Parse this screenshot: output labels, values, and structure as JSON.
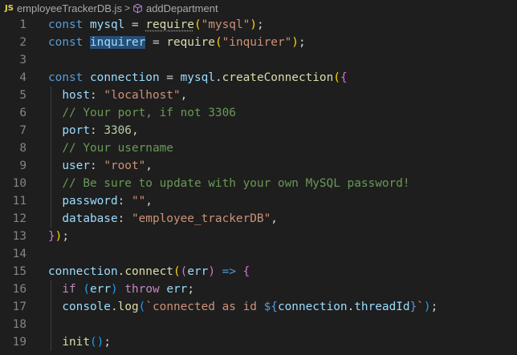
{
  "breadcrumb": {
    "file_badge": "JS",
    "file_name": "employeeTrackerDB.js",
    "separator": ">",
    "symbol_name": "addDepartment"
  },
  "code": {
    "lines": [
      {
        "n": "1",
        "tokens": [
          [
            "kw",
            "const"
          ],
          [
            "pl",
            " "
          ],
          [
            "var",
            "mysql"
          ],
          [
            "pl",
            " = "
          ],
          [
            "fn",
            "require"
          ],
          [
            "br1",
            "("
          ],
          [
            "str",
            "\"mysql\""
          ],
          [
            "br1",
            ")"
          ],
          [
            "pl",
            ";"
          ]
        ]
      },
      {
        "n": "2",
        "tokens": [
          [
            "kw",
            "const"
          ],
          [
            "pl",
            " "
          ],
          [
            "var",
            "inquirer"
          ],
          [
            "pl",
            " = "
          ],
          [
            "fn",
            "require"
          ],
          [
            "br1",
            "("
          ],
          [
            "str",
            "\"inquirer\""
          ],
          [
            "br1",
            ")"
          ],
          [
            "pl",
            ";"
          ]
        ]
      },
      {
        "n": "3",
        "tokens": []
      },
      {
        "n": "4",
        "tokens": [
          [
            "kw",
            "const"
          ],
          [
            "pl",
            " "
          ],
          [
            "var",
            "connection"
          ],
          [
            "pl",
            " = "
          ],
          [
            "var",
            "mysql"
          ],
          [
            "pl",
            "."
          ],
          [
            "fn",
            "createConnection"
          ],
          [
            "br1",
            "("
          ],
          [
            "br2",
            "{"
          ]
        ]
      },
      {
        "n": "5",
        "tokens": [
          [
            "pl",
            "  "
          ],
          [
            "var",
            "host"
          ],
          [
            "pl",
            ": "
          ],
          [
            "str",
            "\"localhost\""
          ],
          [
            "pl",
            ","
          ]
        ]
      },
      {
        "n": "6",
        "tokens": [
          [
            "pl",
            "  "
          ],
          [
            "cm",
            "// Your port, if not 3306"
          ]
        ]
      },
      {
        "n": "7",
        "tokens": [
          [
            "pl",
            "  "
          ],
          [
            "var",
            "port"
          ],
          [
            "pl",
            ": "
          ],
          [
            "num",
            "3306"
          ],
          [
            "pl",
            ","
          ]
        ]
      },
      {
        "n": "8",
        "tokens": [
          [
            "pl",
            "  "
          ],
          [
            "cm",
            "// Your username"
          ]
        ]
      },
      {
        "n": "9",
        "tokens": [
          [
            "pl",
            "  "
          ],
          [
            "var",
            "user"
          ],
          [
            "pl",
            ": "
          ],
          [
            "str",
            "\"root\""
          ],
          [
            "pl",
            ","
          ]
        ]
      },
      {
        "n": "10",
        "tokens": [
          [
            "pl",
            "  "
          ],
          [
            "cm",
            "// Be sure to update with your own MySQL password!"
          ]
        ]
      },
      {
        "n": "11",
        "tokens": [
          [
            "pl",
            "  "
          ],
          [
            "var",
            "password"
          ],
          [
            "pl",
            ": "
          ],
          [
            "str",
            "\"\""
          ],
          [
            "pl",
            ","
          ]
        ]
      },
      {
        "n": "12",
        "tokens": [
          [
            "pl",
            "  "
          ],
          [
            "var",
            "database"
          ],
          [
            "pl",
            ": "
          ],
          [
            "str",
            "\"employee_trackerDB\""
          ],
          [
            "pl",
            ","
          ]
        ]
      },
      {
        "n": "13",
        "tokens": [
          [
            "br2",
            "}"
          ],
          [
            "br1",
            ")"
          ],
          [
            "pl",
            ";"
          ]
        ]
      },
      {
        "n": "14",
        "tokens": []
      },
      {
        "n": "15",
        "tokens": [
          [
            "var",
            "connection"
          ],
          [
            "pl",
            "."
          ],
          [
            "fn",
            "connect"
          ],
          [
            "br1",
            "("
          ],
          [
            "br2",
            "("
          ],
          [
            "var",
            "err"
          ],
          [
            "br2",
            ")"
          ],
          [
            "pl",
            " "
          ],
          [
            "kw",
            "=>"
          ],
          [
            "pl",
            " "
          ],
          [
            "br2",
            "{"
          ]
        ]
      },
      {
        "n": "16",
        "tokens": [
          [
            "pl",
            "  "
          ],
          [
            "ctl",
            "if"
          ],
          [
            "pl",
            " "
          ],
          [
            "br3",
            "("
          ],
          [
            "var",
            "err"
          ],
          [
            "br3",
            ")"
          ],
          [
            "pl",
            " "
          ],
          [
            "ctl",
            "throw"
          ],
          [
            "pl",
            " "
          ],
          [
            "var",
            "err"
          ],
          [
            "pl",
            ";"
          ]
        ]
      },
      {
        "n": "17",
        "tokens": [
          [
            "pl",
            "  "
          ],
          [
            "var",
            "console"
          ],
          [
            "pl",
            "."
          ],
          [
            "fn",
            "log"
          ],
          [
            "br3",
            "("
          ],
          [
            "str",
            "`connected as id "
          ],
          [
            "kw",
            "${"
          ],
          [
            "var",
            "connection"
          ],
          [
            "pl",
            "."
          ],
          [
            "var",
            "threadId"
          ],
          [
            "kw",
            "}"
          ],
          [
            "str",
            "`"
          ],
          [
            "br3",
            ")"
          ],
          [
            "pl",
            ";"
          ]
        ]
      },
      {
        "n": "18",
        "tokens": []
      },
      {
        "n": "19",
        "tokens": [
          [
            "pl",
            "  "
          ],
          [
            "fn",
            "init"
          ],
          [
            "br3",
            "("
          ],
          [
            "br3",
            ")"
          ],
          [
            "pl",
            ";"
          ]
        ]
      }
    ]
  },
  "colors": {
    "background": "#1e1e1e",
    "line_number": "#858585",
    "keyword": "#569cd6",
    "control": "#c586c0",
    "variable": "#9cdcfe",
    "function": "#dcdcaa",
    "string": "#ce9178",
    "number": "#b5cea8",
    "comment": "#6a9955",
    "selection": "#264f78"
  },
  "icons": {
    "symbol": "cube-icon"
  }
}
